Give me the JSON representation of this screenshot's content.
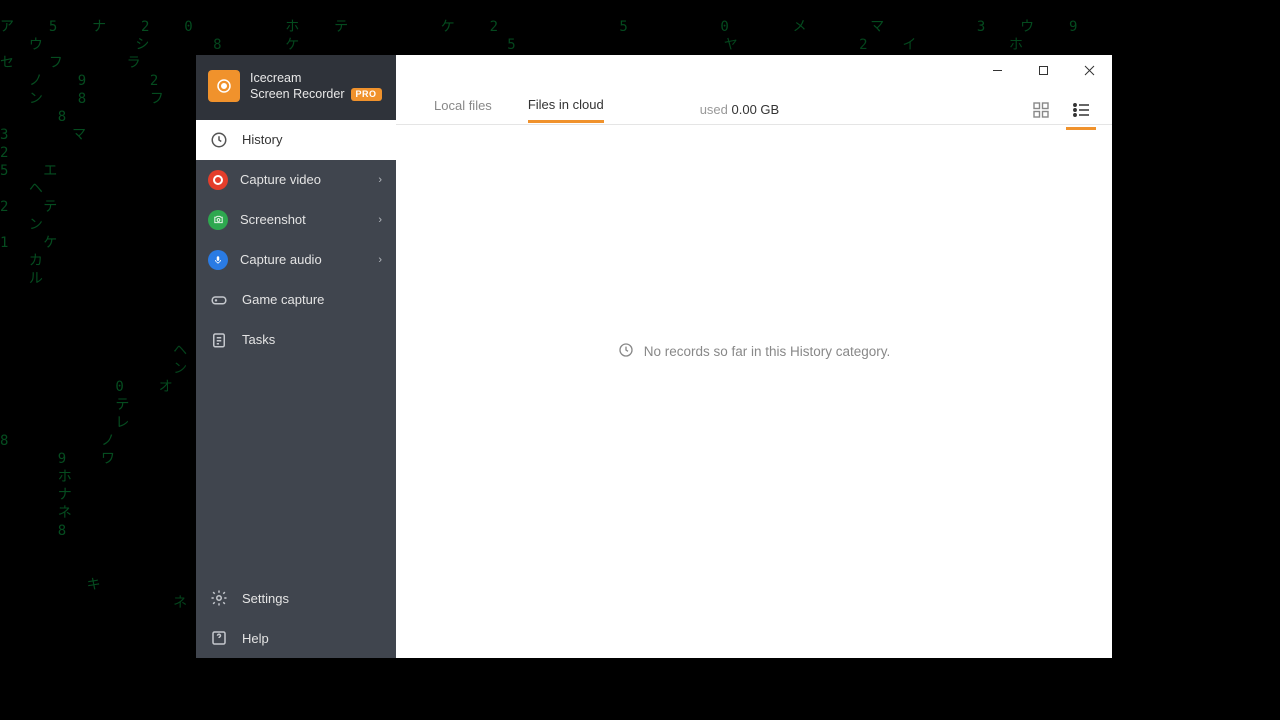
{
  "brand": {
    "line1": "Icecream",
    "line2": "Screen Recorder",
    "badge": "PRO"
  },
  "sidebar": {
    "items": [
      {
        "label": "History"
      },
      {
        "label": "Capture video"
      },
      {
        "label": "Screenshot"
      },
      {
        "label": "Capture audio"
      },
      {
        "label": "Game capture"
      },
      {
        "label": "Tasks"
      }
    ],
    "footer": [
      {
        "label": "Settings"
      },
      {
        "label": "Help"
      }
    ]
  },
  "tabs": {
    "local": "Local files",
    "cloud": "Files in cloud"
  },
  "storage": {
    "label": "used",
    "value": "0.00 GB"
  },
  "empty": {
    "message": "No records so far in this History category."
  }
}
